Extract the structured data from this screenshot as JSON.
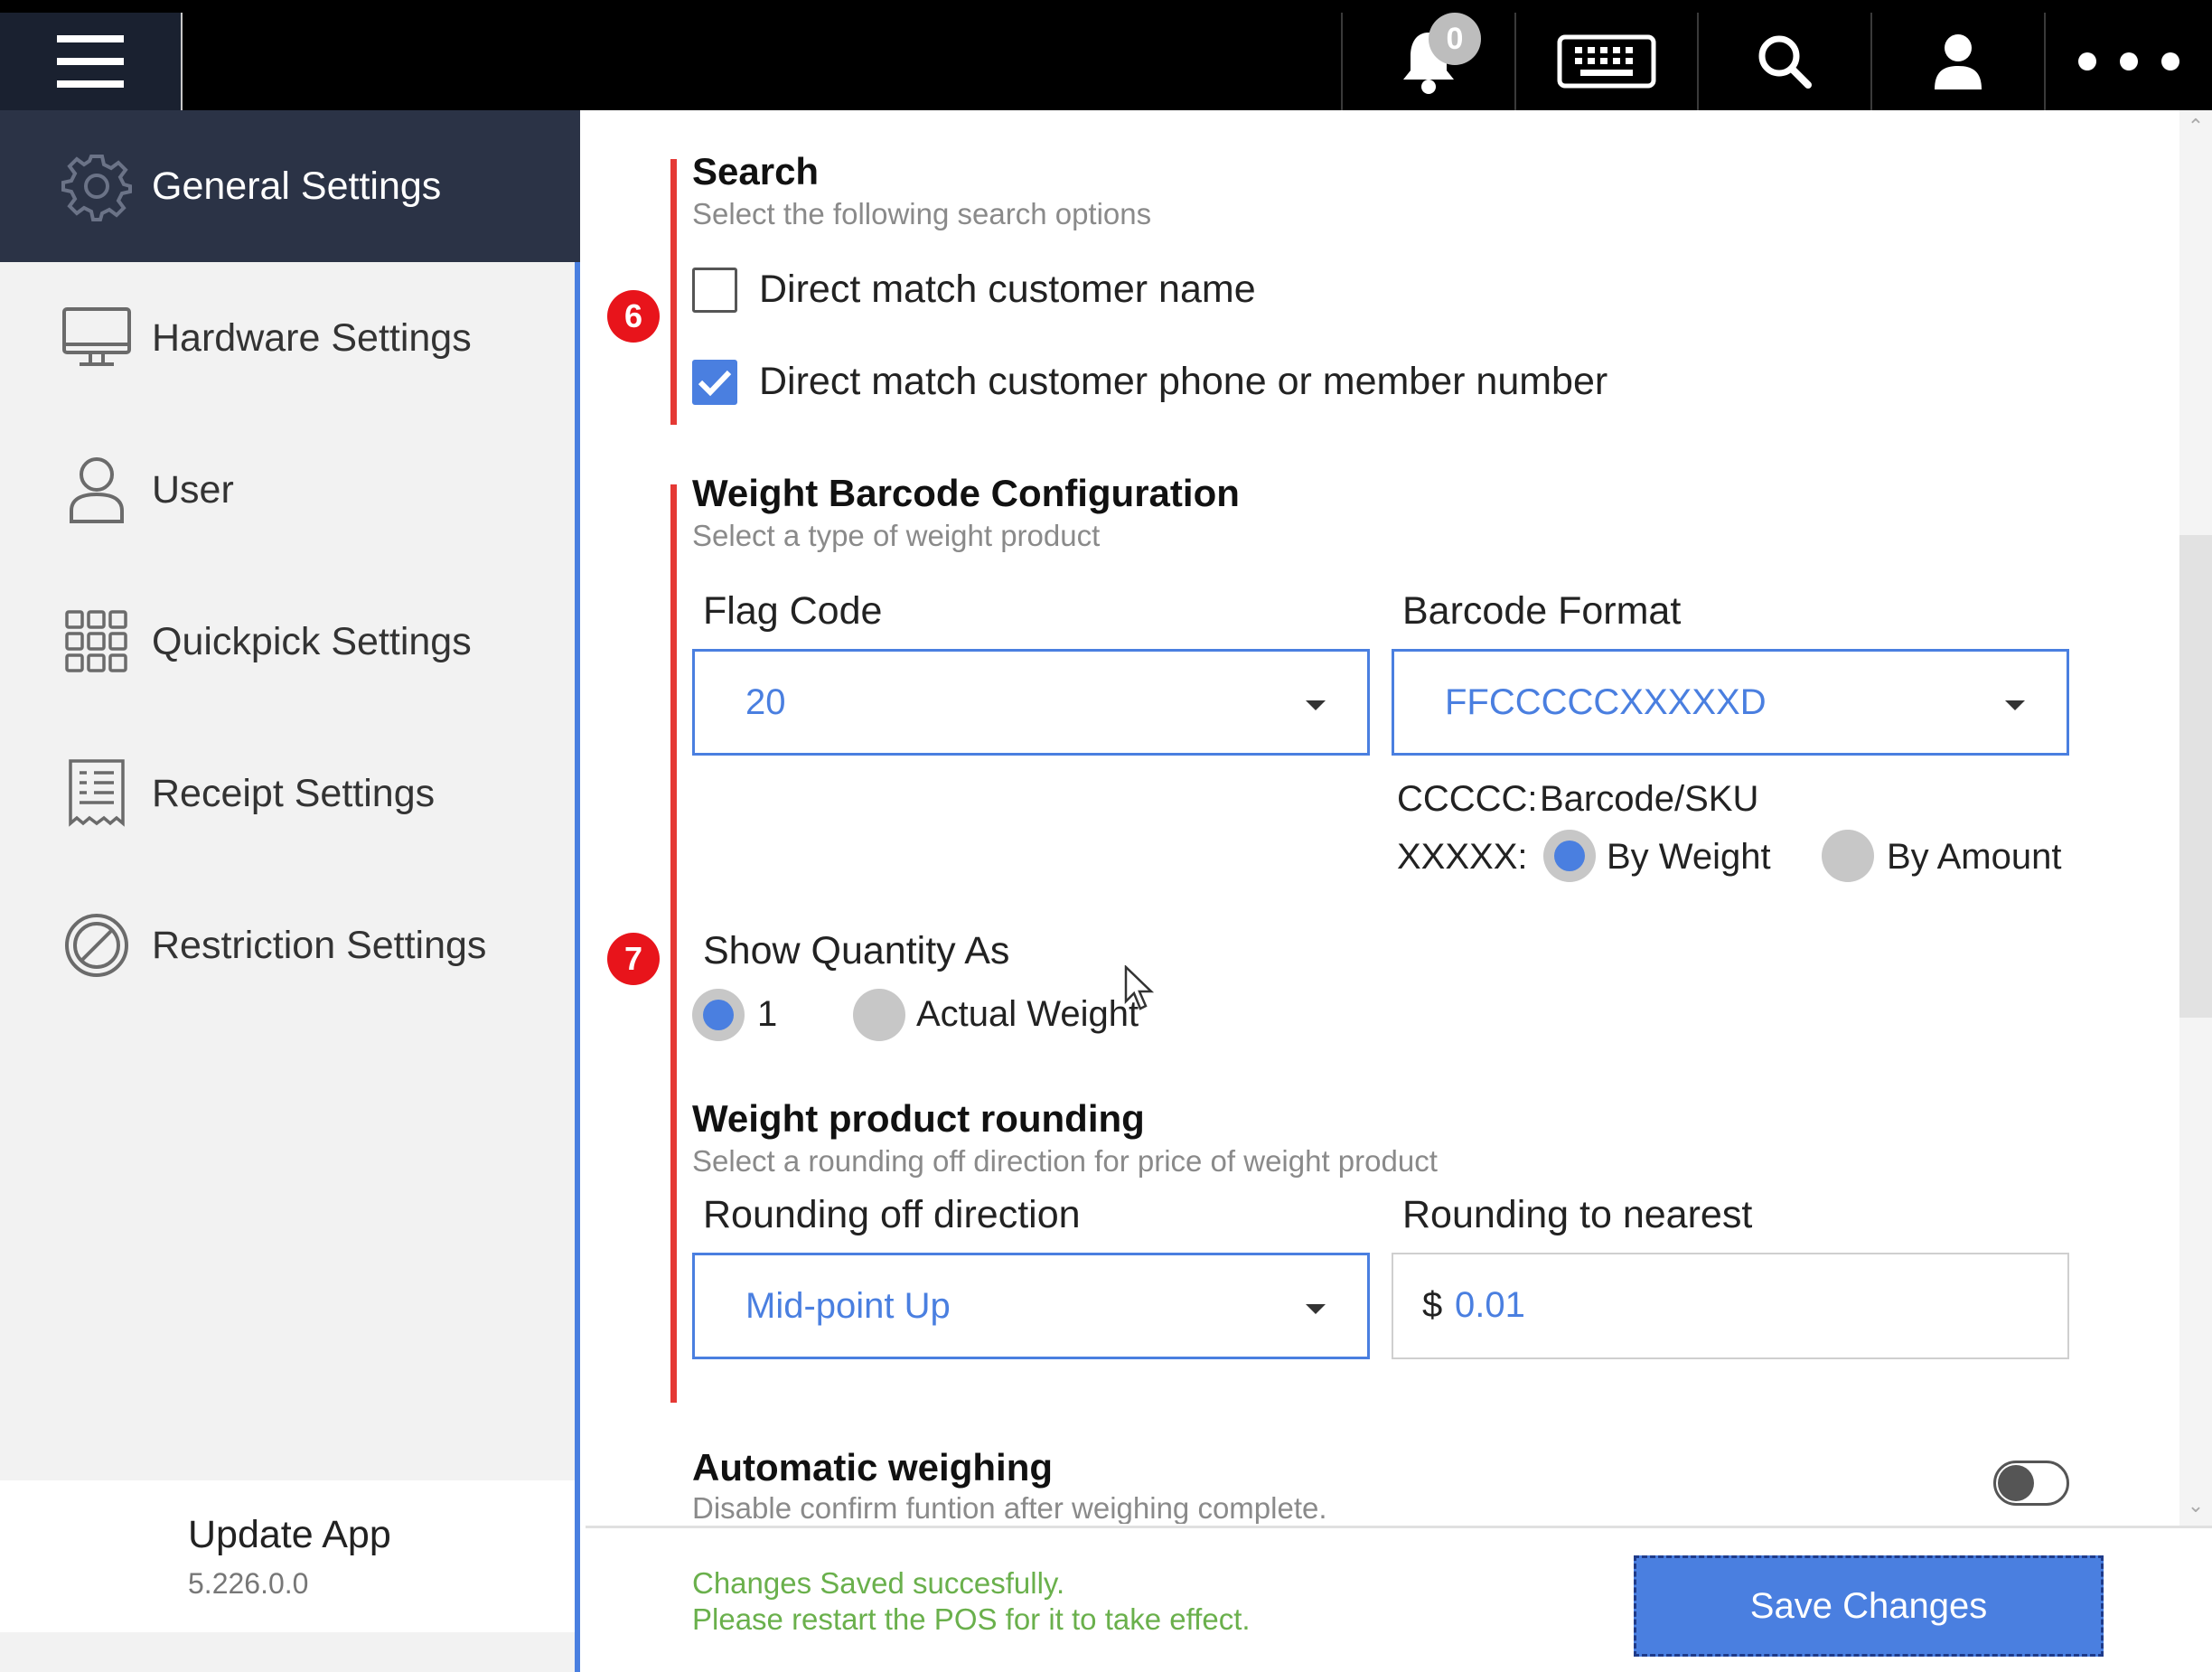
{
  "topbar": {
    "notifications": {
      "icon": "bell-icon",
      "count": "0"
    },
    "icons": [
      "menu-icon",
      "keyboard-icon",
      "search-icon",
      "user-icon",
      "more-icon"
    ]
  },
  "sidebar": {
    "items": [
      {
        "label": "General Settings",
        "icon": "gear-icon",
        "active": true
      },
      {
        "label": "Hardware Settings",
        "icon": "monitor-icon",
        "active": false
      },
      {
        "label": "User",
        "icon": "user-icon",
        "active": false
      },
      {
        "label": "Quickpick Settings",
        "icon": "grid-icon",
        "active": false
      },
      {
        "label": "Receipt Settings",
        "icon": "receipt-icon",
        "active": false
      },
      {
        "label": "Restriction Settings",
        "icon": "restriction-icon",
        "active": false
      }
    ],
    "update": {
      "title": "Update App",
      "version": "5.226.0.0"
    }
  },
  "markers": {
    "search": "6",
    "weight": "7"
  },
  "search": {
    "title": "Search",
    "subtitle": "Select the following search options",
    "options": [
      {
        "label": "Direct match customer name",
        "checked": false
      },
      {
        "label": "Direct match customer phone or member number",
        "checked": true
      }
    ]
  },
  "weight_barcode": {
    "title": "Weight Barcode Configuration",
    "subtitle": "Select a type of weight product",
    "flag_code": {
      "label": "Flag Code",
      "value": "20"
    },
    "barcode_format": {
      "label": "Barcode Format",
      "value": "FFCCCCCXXXXXD"
    },
    "cccc_key": "CCCCC:",
    "cccc_value": "Barcode/SKU",
    "xxxx_key": "XXXXX:",
    "xxxx_options": [
      {
        "label": "By Weight",
        "selected": true
      },
      {
        "label": "By Amount",
        "selected": false
      }
    ],
    "show_quantity": {
      "label": "Show Quantity As",
      "options": [
        {
          "label": "1",
          "selected": true
        },
        {
          "label": "Actual Weight",
          "selected": false
        }
      ]
    }
  },
  "rounding": {
    "title": "Weight product rounding",
    "subtitle": "Select a rounding off direction for price of weight product",
    "direction": {
      "label": "Rounding off direction",
      "value": "Mid-point Up"
    },
    "nearest": {
      "label": "Rounding to nearest",
      "currency": "$",
      "value": "0.01"
    }
  },
  "auto_weighing": {
    "title": "Automatic weighing",
    "subtitle": "Disable confirm funtion after weighing complete.",
    "enabled": false
  },
  "footer": {
    "message_line1": "Changes Saved succesfully.",
    "message_line2": "Please restart the POS for it to take effect.",
    "save_label": "Save Changes"
  },
  "colors": {
    "accent": "#4a7fe0",
    "sidebar_active": "#2b3346",
    "marker": "#e8141b",
    "success": "#6ab04c"
  }
}
